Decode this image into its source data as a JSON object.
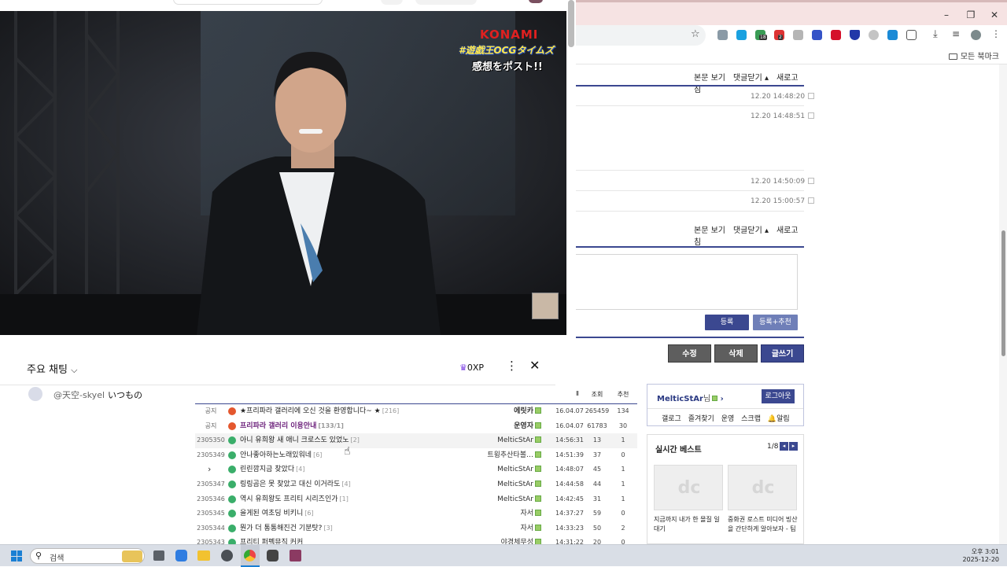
{
  "browser": {
    "bookmarks_folder": "모든 북마크",
    "ext_badges": [
      "18",
      "2"
    ],
    "comments": {
      "actions_top": [
        "본문 보기",
        "댓글닫기 ▴",
        "새로고침"
      ],
      "actions_bottom": [
        "본문 보기",
        "댓글닫기 ▴",
        "새로고침"
      ],
      "times": [
        "12.20 14:48:20",
        "12.20 14:48:51",
        "12.20 14:50:09",
        "12.20 15:00:57"
      ],
      "submit_label": "등록",
      "submit_recommend_label": "등록+추천"
    },
    "post_buttons": {
      "edit": "수정",
      "delete": "삭제",
      "write": "글쓰기"
    },
    "login": {
      "username": "MelticStAr",
      "suffix": "님",
      "logout": "로그아웃",
      "links": [
        "갤로그",
        "즐겨찾기",
        "운영",
        "스크랩",
        "알림"
      ]
    },
    "best": {
      "title": "실시간 베스트",
      "page": "1/8",
      "items": [
        "지금까지 내가 한 몰질 일대기",
        "중화권 로스트 미디어 빙산을 간단하게 알아보자 - 팀"
      ]
    }
  },
  "video": {
    "brand": "KONAMI",
    "hashtag": "#遊戯王OCGタイムズ",
    "caption": "感想をポスト!!"
  },
  "chat": {
    "title": "주요 채팅",
    "xp": "0XP",
    "message_author": "@天空-skyel",
    "message_text": "いつもの"
  },
  "forum": {
    "headers": {
      "views": "조회",
      "recommend": "추천"
    },
    "rows": [
      {
        "no": "공지",
        "icon": "notice",
        "title": "★프리파라 갤러리에 오신 것을 환영합니다~ ★",
        "count": "[216]",
        "author": "에릿카",
        "date": "16.04.07",
        "views": "265459",
        "rec": "134",
        "bold": false
      },
      {
        "no": "공지",
        "icon": "notice",
        "title": "프리파라 갤러리 이용안내",
        "count": "[133/1]",
        "author": "운영자",
        "date": "16.04.07",
        "views": "61783",
        "rec": "30",
        "bold": true
      },
      {
        "no": "2305350",
        "icon": "post",
        "title": "아니 유희왕 새 애니 크로스도 있었노",
        "count": "[2]",
        "author": "MelticStAr",
        "date": "14:56:31",
        "views": "13",
        "rec": "1",
        "bold": false
      },
      {
        "no": "2305349",
        "icon": "post",
        "title": "안나좋아하는노래있워네",
        "count": "[6]",
        "author": "트윙추산타볼…",
        "date": "14:51:39",
        "views": "37",
        "rec": "0",
        "bold": false
      },
      {
        "no": "",
        "icon": "post",
        "title": "린린깜지금 찾았다",
        "count": "[4]",
        "author": "MelticStAr",
        "date": "14:48:07",
        "views": "45",
        "rec": "1",
        "bold": false
      },
      {
        "no": "2305347",
        "icon": "post",
        "title": "링링곰은 못 찾았고 대신 이거라도",
        "count": "[4]",
        "author": "MelticStAr",
        "date": "14:44:58",
        "views": "44",
        "rec": "1",
        "bold": false
      },
      {
        "no": "2305346",
        "icon": "post",
        "title": "역시 유희왕도 프리티 시리즈인가",
        "count": "[1]",
        "author": "MelticStAr",
        "date": "14:42:45",
        "views": "31",
        "rec": "1",
        "bold": false
      },
      {
        "no": "2305345",
        "icon": "post",
        "title": "을게된 여초딩 비키니",
        "count": "[6]",
        "author": "자서",
        "date": "14:37:27",
        "views": "59",
        "rec": "0",
        "bold": false
      },
      {
        "no": "2305344",
        "icon": "post",
        "title": "뭔가 더 통통해진건 기분탓?",
        "count": "[3]",
        "author": "자서",
        "date": "14:33:23",
        "views": "50",
        "rec": "2",
        "bold": false
      },
      {
        "no": "2305343",
        "icon": "post",
        "title": "프리티 퍼펙뮤직 커커",
        "count": "",
        "author": "야경체무성",
        "date": "14:31:22",
        "views": "20",
        "rec": "0",
        "bold": false
      }
    ]
  },
  "taskbar": {
    "search_placeholder": "검색",
    "time": "오후 3:01",
    "date": "2025-12-20"
  }
}
